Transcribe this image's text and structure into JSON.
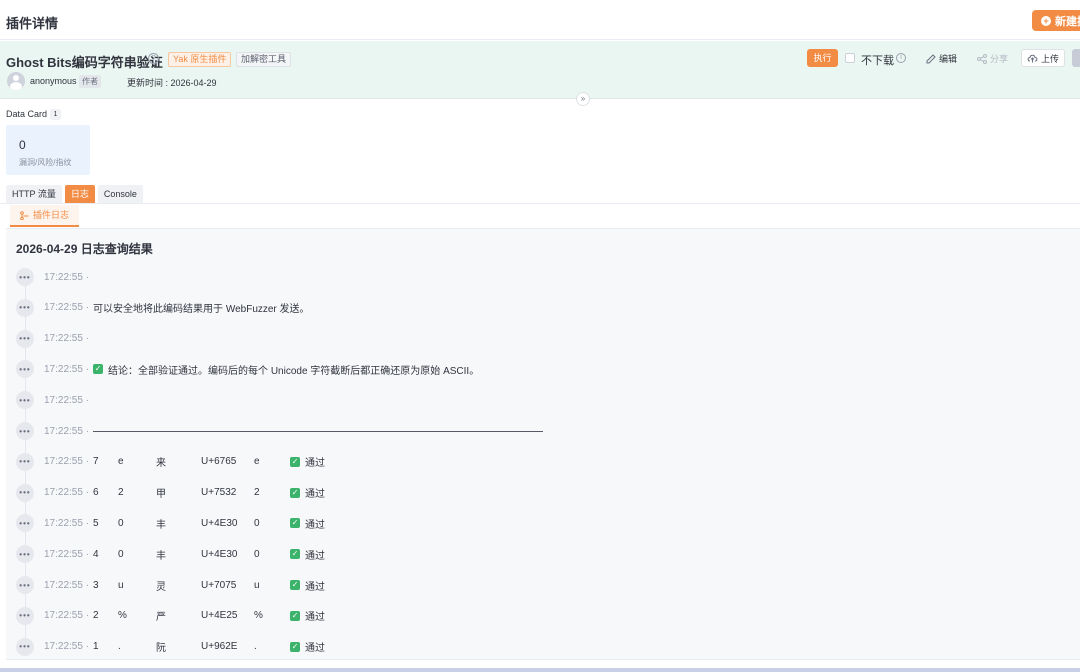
{
  "header": {
    "title": "插件详情",
    "new_button": "新建插"
  },
  "plugin": {
    "name": "Ghost Bits编码字符串验证",
    "tags": [
      "Yak 原生插件",
      "加解密工具"
    ],
    "author": "anonymous",
    "author_role": "作者",
    "updated": "更新时间 : 2026-04-29",
    "actions": {
      "execute": "执行",
      "no_download": "不下载",
      "edit": "编辑",
      "share": "分享",
      "upload": "上传"
    }
  },
  "data_card": {
    "label": "Data Card",
    "count": "1",
    "value": "0",
    "desc": "漏洞/风险/指纹"
  },
  "tabs": [
    {
      "label": "HTTP 流量",
      "active": false
    },
    {
      "label": "日志",
      "active": true
    },
    {
      "label": "Console",
      "active": false
    }
  ],
  "subtab": {
    "label": "插件日志"
  },
  "log": {
    "title": "2026-04-29 日志查询结果",
    "rows": [
      {
        "time": "17:22:55 ·",
        "text": ""
      },
      {
        "time": "17:22:55 ·",
        "text": "可以安全地将此编码结果用于 WebFuzzer 发送。"
      },
      {
        "time": "17:22:55 ·",
        "text": ""
      },
      {
        "time": "17:22:55 ·",
        "text": "结论：全部验证通过。编码后的每个 Unicode 字符截断后都正确还原为原始 ASCII。",
        "check": true
      },
      {
        "time": "17:22:55 ·",
        "text": ""
      },
      {
        "time": "17:22:55 ·",
        "divider": true
      },
      {
        "time": "17:22:55 ·",
        "cols": [
          "7",
          "e",
          "来",
          "U+6765",
          "e",
          "通过"
        ]
      },
      {
        "time": "17:22:55 ·",
        "cols": [
          "6",
          "2",
          "甲",
          "U+7532",
          "2",
          "通过"
        ]
      },
      {
        "time": "17:22:55 ·",
        "cols": [
          "5",
          "0",
          "丰",
          "U+4E30",
          "0",
          "通过"
        ]
      },
      {
        "time": "17:22:55 ·",
        "cols": [
          "4",
          "0",
          "丰",
          "U+4E30",
          "0",
          "通过"
        ]
      },
      {
        "time": "17:22:55 ·",
        "cols": [
          "3",
          "u",
          "灵",
          "U+7075",
          "u",
          "通过"
        ]
      },
      {
        "time": "17:22:55 ·",
        "cols": [
          "2",
          "%",
          "严",
          "U+4E25",
          "%",
          "通过"
        ]
      },
      {
        "time": "17:22:55 ·",
        "cols": [
          "1",
          ".",
          "阮",
          "U+962E",
          ".",
          "通过"
        ]
      }
    ]
  }
}
